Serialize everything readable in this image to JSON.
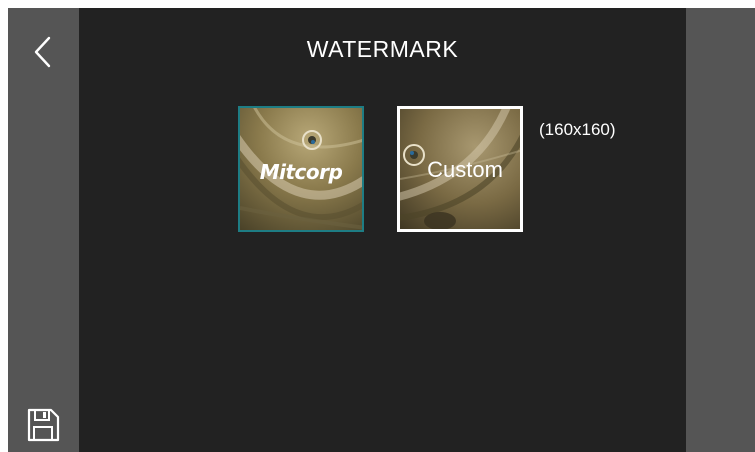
{
  "header": {
    "title": "WATERMARK"
  },
  "nav": {
    "back_icon": "chevron-left-icon",
    "save_icon": "floppy-disk-icon"
  },
  "watermarks": {
    "options": [
      {
        "label": "Mitcorp",
        "selected": false,
        "border_color": "#1e7d84"
      },
      {
        "label": "Custom",
        "selected": true,
        "border_color": "#ffffff"
      }
    ],
    "custom_size": "(160x160)"
  },
  "colors": {
    "background": "#222222",
    "side_rail": "#555555",
    "text": "#ffffff",
    "accent": "#1e7d84"
  }
}
